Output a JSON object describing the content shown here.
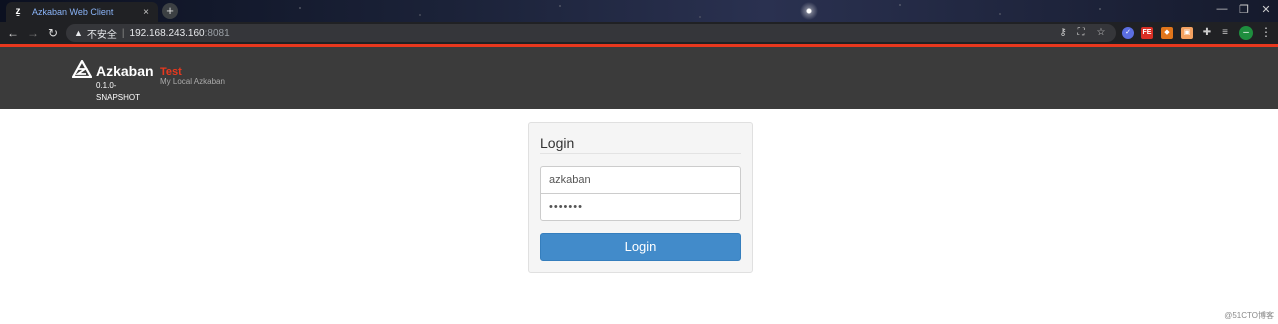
{
  "browser": {
    "tab_title": "Azkaban Web Client",
    "tab_close": "×",
    "new_tab": "+",
    "window_controls": [
      "—",
      "❐",
      "✕"
    ],
    "address": {
      "security_label": "不安全",
      "host": "192.168.243.160",
      "port": ":8081"
    },
    "icons": [
      "key-icon",
      "translate-icon",
      "star-icon",
      "ext-blue-icon",
      "ext-red-icon",
      "ext-fox-icon",
      "ext-orange-icon",
      "puzzle-icon",
      "reading-list-icon",
      "profile-icon",
      "menu-icon"
    ]
  },
  "header": {
    "brand": "Azkaban",
    "version": "0.1.0-SNAPSHOT",
    "env_name": "Test",
    "env_description": "My Local Azkaban"
  },
  "login": {
    "title": "Login",
    "username_value": "azkaban",
    "password_mask": "•••••••",
    "button_label": "Login"
  },
  "watermark": "@51CTO博客",
  "colors": {
    "accent_red": "#e8381e",
    "header_bg": "#3b3b3b",
    "button_blue": "#428bca"
  }
}
